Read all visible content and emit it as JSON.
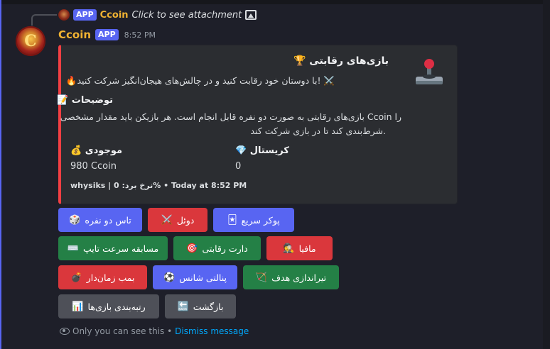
{
  "reply": {
    "app_badge": "APP",
    "name": "Ccoin",
    "text": "Click to see attachment"
  },
  "message": {
    "author": "Ccoin",
    "app_badge": "APP",
    "time": "8:52 PM"
  },
  "embed": {
    "accent_color": "#f23f43",
    "title": "🏆 بازی‌های رقابتی",
    "description": "🔥با دوستان خود رقابت کنید و در چالش‌های هیجان‌انگیز شرکت کنید! ⚔️",
    "section_title": "📝 توضیحات",
    "section_line1": "بازی‌های رقابتی به صورت دو نفره قابل انجام است. هر بازیکن باید مقدار مشخصی Ccoin را",
    "section_line2": "شرط‌بندی کند تا در بازی شرکت کند.",
    "field_balance_name": "💰 موجودی",
    "field_balance_value": "980 Ccoin",
    "field_crystal_name": "💎 کریستال",
    "field_crystal_value": "0",
    "footer": "whysiks | 0 :نرخ برد% • Today at 8:52 PM"
  },
  "buttons": {
    "dice": {
      "label": "تاس دو نفره",
      "icon": "🎲"
    },
    "duel": {
      "label": "دوئل",
      "icon": "⚔️"
    },
    "poker": {
      "label": "پوکر سریع",
      "icon": "🃏"
    },
    "typing": {
      "label": "مسابقه سرعت تایپ",
      "icon": "⌨️"
    },
    "darts": {
      "label": "دارت رقابتی",
      "icon": "🎯"
    },
    "mafia": {
      "label": "مافیا",
      "icon": "🕵️"
    },
    "bomb": {
      "label": "بمب زمان‌دار",
      "icon": "💣"
    },
    "penalty": {
      "label": "پنالتی شانس",
      "icon": "⚽"
    },
    "shooting": {
      "label": "تیراندازی هدف",
      "icon": "🏹"
    },
    "ranking": {
      "label": "رتبه‌بندی بازی‌ها",
      "icon": "📊"
    },
    "back": {
      "label": "بازگشت",
      "icon": "🔙"
    }
  },
  "ephemeral": {
    "text": "Only you can see this •",
    "dismiss": "Dismiss message"
  }
}
